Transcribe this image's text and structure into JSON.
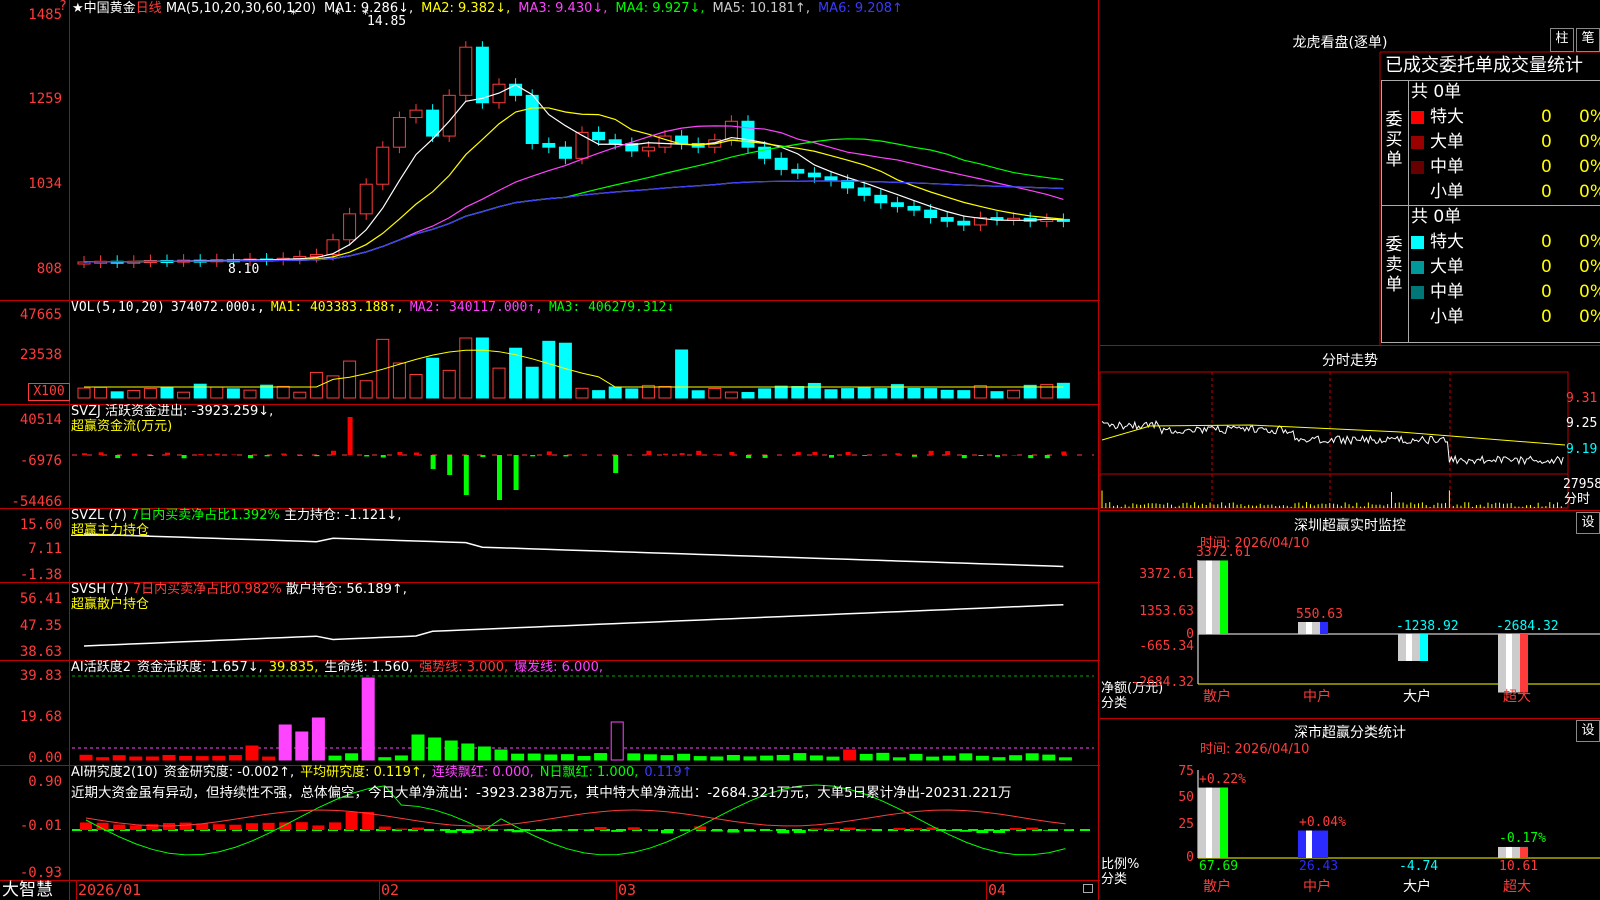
{
  "stock": {
    "name": "★中国黄金",
    "period": "日线"
  },
  "main_chart": {
    "ma_legend": [
      {
        "text": "MA(5,10,20,30,60,120)",
        "color": "#ffffff"
      },
      {
        "text": "MA1: 9.286↓,",
        "color": "#ffffff"
      },
      {
        "text": "MA2: 9.382↓,",
        "color": "#ffff00"
      },
      {
        "text": "MA3: 9.430↓,",
        "color": "#ff44ff"
      },
      {
        "text": "MA4: 9.927↓,",
        "color": "#00ff00"
      },
      {
        "text": "MA5: 10.181↑,",
        "color": "#cccccc"
      },
      {
        "text": "MA6: 9.208↑",
        "color": "#3a3aff"
      }
    ],
    "y_labels": [
      "1485",
      "1259",
      "1034",
      "808"
    ],
    "high_mark": "14.85",
    "low_mark": "8.10"
  },
  "vol_pane": {
    "legend": [
      {
        "text": "VOL(5,10,20)",
        "color": "#ffffff"
      },
      {
        "text": "374072.000↓,",
        "color": "#ffffff"
      },
      {
        "text": "MA1: 403383.188↑,",
        "color": "#ffff00"
      },
      {
        "text": "MA2: 340117.000↑,",
        "color": "#ff44ff"
      },
      {
        "text": "MA3: 406279.312↓",
        "color": "#00ff00"
      }
    ],
    "y_labels": [
      "47665",
      "23538"
    ],
    "unit": "X100"
  },
  "svzj_pane": {
    "legend1": "SVZJ  活跃资金进出: -3923.259↓,",
    "legend2": "超赢资金流(万元)",
    "y_labels": [
      "40514",
      "-6976",
      "-54466"
    ]
  },
  "svzl_pane": {
    "legend_a": "SVZL (7)",
    "legend_b": "7日内买卖净占比1.392%",
    "legend_c": "主力持仓: -1.121↓,",
    "legend2": "超赢主力持仓",
    "y_labels": [
      "15.60",
      "7.11",
      "-1.38"
    ]
  },
  "svsh_pane": {
    "legend_a": "SVSH (7)",
    "legend_b": "7日内买卖净占比0.982%",
    "legend_c": "散户持仓: 56.189↑,",
    "legend2": "超赢散户持仓",
    "y_labels": [
      "56.41",
      "47.35",
      "38.63"
    ]
  },
  "ai_active_pane": {
    "legend": [
      {
        "text": "AI活跃度2",
        "color": "#ffffff"
      },
      {
        "text": "资金活跃度: 1.657↓,",
        "color": "#ffffff"
      },
      {
        "text": "39.835,",
        "color": "#ffff00"
      },
      {
        "text": "生命线: 1.560,",
        "color": "#ffffff"
      },
      {
        "text": "强势线: 3.000,",
        "color": "#ff3b3b"
      },
      {
        "text": "爆发线: 6.000,",
        "color": "#ff44ff"
      }
    ],
    "y_labels": [
      "39.83",
      "19.68",
      "0.00"
    ]
  },
  "ai_research_pane": {
    "legend": [
      {
        "text": "AI研究度2(10)",
        "color": "#ffffff"
      },
      {
        "text": "资金研究度: -0.002↑,",
        "color": "#ffffff"
      },
      {
        "text": "平均研究度: 0.119↑,",
        "color": "#ffff00"
      },
      {
        "text": "连续飘红: 0.000,",
        "color": "#ff44ff"
      },
      {
        "text": "N日飘红: 1.000,",
        "color": "#00ff00"
      },
      {
        "text": "0.119↑",
        "color": "#3a3aff"
      }
    ],
    "comment": "近期大资金虽有异动，但持续性不强，总体偏空，今日大单净流出：-3923.238万元，其中特大单净流出：-2684.321万元，大单5日累计净出-20231.221万",
    "y_labels": [
      "0.90",
      "-0.01",
      "-0.93"
    ]
  },
  "x_axis": {
    "labels": [
      "2026/01",
      "02",
      "03",
      "04"
    ]
  },
  "brand": "大智慧",
  "right_panel": {
    "dragon": {
      "title": "龙虎看盘(逐单)",
      "btn1": "柱",
      "btn2": "笔",
      "subtitle": "已成交委托单成交量统计",
      "buy_label": "委买单",
      "sell_label": "委卖单",
      "buy_total": "共 0单",
      "sell_total": "共 0单",
      "buy_rows": [
        {
          "name": "特大",
          "count": "0",
          "pct": "0%",
          "color": "#ff0000"
        },
        {
          "name": "大单",
          "count": "0",
          "pct": "0%",
          "color": "#990000"
        },
        {
          "name": "中单",
          "count": "0",
          "pct": "0%",
          "color": "#660000"
        },
        {
          "name": "小单",
          "count": "0",
          "pct": "0%",
          "color": "#000000"
        }
      ],
      "sell_rows": [
        {
          "name": "特大",
          "count": "0",
          "pct": "0%",
          "color": "#00ffff"
        },
        {
          "name": "大单",
          "count": "0",
          "pct": "0%",
          "color": "#009999"
        },
        {
          "name": "中单",
          "count": "0",
          "pct": "0%",
          "color": "#007777"
        },
        {
          "name": "小单",
          "count": "0",
          "pct": "0%",
          "color": "#000000"
        }
      ]
    },
    "minute": {
      "title": "分时走势",
      "y_labels": [
        "9.31",
        "9.25",
        "9.19"
      ],
      "vol_label": "27958",
      "vol_unit": "分时"
    },
    "realtime": {
      "title": "深圳超赢实时监控",
      "btn": "设",
      "time": "时间: 2026/04/10",
      "y_labels": [
        "3372.61",
        "1353.63",
        "0",
        "-665.34",
        "-2684.32"
      ],
      "y_title": "净额(万元)",
      "cat_title": "分类",
      "categories": [
        "散户",
        "中户",
        "大户",
        "超大"
      ],
      "values": [
        3372.61,
        550.63,
        -1238.92,
        -2684.32
      ],
      "value_labels": [
        "3372.61",
        "550.63",
        "-1238.92",
        "-2684.32"
      ]
    },
    "classify": {
      "title": "深市超赢分类统计",
      "btn": "设",
      "time": "时间: 2026/04/10",
      "y_labels": [
        "75",
        "50",
        "25",
        "0"
      ],
      "y_title": "比例%",
      "cat_title": "分类",
      "categories": [
        "散户",
        "中户",
        "大户",
        "超大"
      ],
      "values": [
        67.69,
        26.43,
        -4.74,
        10.61
      ],
      "value_labels": [
        "67.69",
        "26.43",
        "-4.74",
        "10.61"
      ],
      "change_labels": [
        "+0.22%",
        "+0.04%",
        "",
        "-0.17%"
      ]
    }
  }
}
